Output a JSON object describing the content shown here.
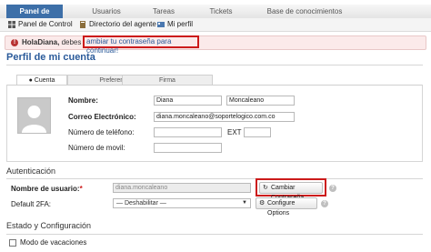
{
  "topnav": {
    "tabs": [
      {
        "label": "Panel de Control"
      },
      {
        "label": "Usuarios"
      },
      {
        "label": "Tareas"
      },
      {
        "label": "Tickets"
      },
      {
        "label": "Base de conocimientos"
      }
    ]
  },
  "subnav": {
    "items": [
      {
        "label": "Panel de Control",
        "icon": "dashboard-icon"
      },
      {
        "label": "Directorio del agente",
        "icon": "directory-icon"
      },
      {
        "label": "Mi perfil",
        "icon": "profile-icon"
      }
    ]
  },
  "alert": {
    "greeting": "HolaDiana,",
    "text": " debes ",
    "link": "ambiar tu contraseña para continuar!",
    "color": "#cc1b1b"
  },
  "page": {
    "title": "Perfil de mi cuenta"
  },
  "tabs": [
    {
      "label": "Cuenta",
      "icon": "user-icon",
      "active": true
    },
    {
      "label": "Preferencias"
    },
    {
      "label": "Firma"
    }
  ],
  "account": {
    "name_label": "Nombre:",
    "first_name": "Diana",
    "last_name": "Moncaleano",
    "email_label": "Correo Electrónico:",
    "email": "diana.moncaleano@soportelogico.com.co",
    "phone_label": "Número de teléfono:",
    "ext_label": "EXT",
    "mobile_label": "Número de movil:"
  },
  "auth": {
    "section": "Autenticación",
    "username_label": "Nombre de usuario:",
    "required_mark": "*",
    "username": "diana.moncaleano",
    "change_password": "Cambiar Contraseña",
    "twofa_label": "Default 2FA:",
    "twofa_value": "— Deshabilitar —",
    "configure": "Configure Options"
  },
  "status": {
    "section": "Estado y Configuración",
    "vacation_label": "Modo de vacaciones"
  },
  "colors": {
    "brand": "#2a5a9a",
    "active_tab": "#3d6fa8",
    "highlight": "#cc1b1b"
  }
}
